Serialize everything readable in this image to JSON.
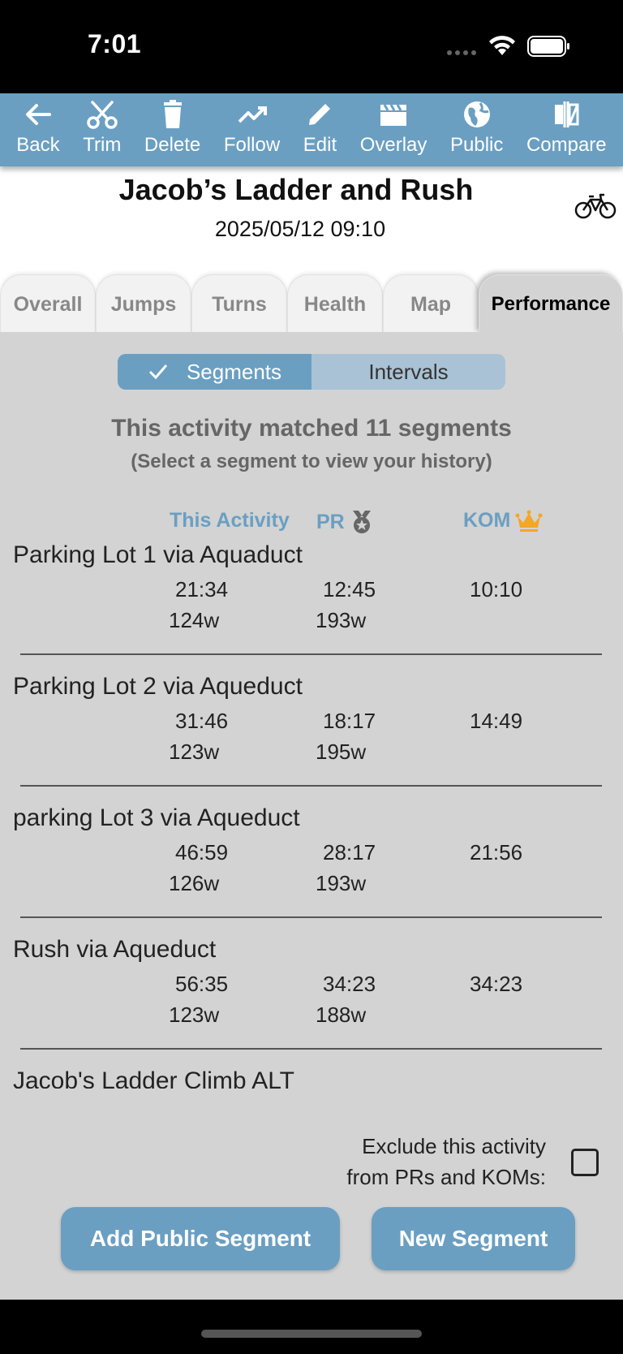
{
  "status_bar": {
    "time": "7:01"
  },
  "toolbar": {
    "items": [
      {
        "label": "Back",
        "icon": "back-arrow-icon"
      },
      {
        "label": "Trim",
        "icon": "scissors-icon"
      },
      {
        "label": "Delete",
        "icon": "trash-icon"
      },
      {
        "label": "Follow",
        "icon": "trend-icon"
      },
      {
        "label": "Edit",
        "icon": "pencil-icon"
      },
      {
        "label": "Overlay",
        "icon": "clapperboard-icon"
      },
      {
        "label": "Public",
        "icon": "globe-icon"
      },
      {
        "label": "Compare",
        "icon": "compare-icon"
      }
    ]
  },
  "activity": {
    "title": "Jacob’s Ladder and Rush",
    "datetime": "2025/05/12 09:10",
    "type_icon": "bicycle-icon"
  },
  "tabs": [
    {
      "label": "Overall",
      "active": false
    },
    {
      "label": "Jumps",
      "active": false
    },
    {
      "label": "Turns",
      "active": false
    },
    {
      "label": "Health",
      "active": false
    },
    {
      "label": "Map",
      "active": false
    },
    {
      "label": "Performance",
      "active": true
    }
  ],
  "toggle": {
    "segments": "Segments",
    "intervals": "Intervals",
    "selected": "Segments"
  },
  "summary": {
    "title": "This activity matched 11 segments",
    "subtitle": "(Select a segment to view your history)"
  },
  "columns": {
    "this_activity": "This Activity",
    "pr": "PR",
    "kom": "KOM"
  },
  "segments": [
    {
      "name": "Parking  Lot  1 via Aquaduct",
      "time": "21:34",
      "pr_time": "12:45",
      "kom_time": "10:10",
      "power": "124w",
      "pr_power": "193w"
    },
    {
      "name": "Parking Lot 2 via Aqueduct",
      "time": "31:46",
      "pr_time": "18:17",
      "kom_time": "14:49",
      "power": "123w",
      "pr_power": "195w"
    },
    {
      "name": "parking Lot 3 via Aqueduct",
      "time": "46:59",
      "pr_time": "28:17",
      "kom_time": "21:56",
      "power": "126w",
      "pr_power": "193w"
    },
    {
      "name": "Rush via Aqueduct",
      "time": "56:35",
      "pr_time": "34:23",
      "kom_time": "34:23",
      "power": "123w",
      "pr_power": "188w"
    },
    {
      "name": "Jacob's Ladder Climb ALT"
    }
  ],
  "exclude": {
    "line1": "Exclude this activity",
    "line2": "from PRs and KOMs:",
    "checked": false
  },
  "buttons": {
    "add_public": "Add Public Segment",
    "new_segment": "New Segment"
  },
  "colors": {
    "accent": "#6a9fc2",
    "accent_light": "#a9c2d5",
    "background": "#d3d3d3",
    "crown": "#f5a623"
  }
}
